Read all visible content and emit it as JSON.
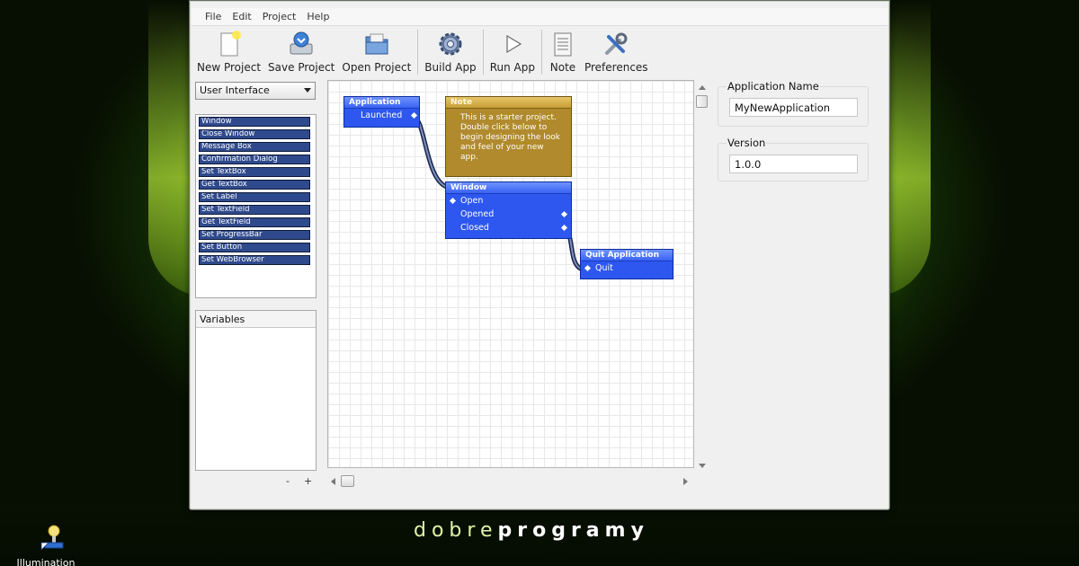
{
  "menu": [
    "File",
    "Edit",
    "Project",
    "Help"
  ],
  "toolbar": {
    "new_project": "New Project",
    "save_project": "Save Project",
    "open_project": "Open Project",
    "build_app": "Build App",
    "run_app": "Run App",
    "note": "Note",
    "preferences": "Preferences"
  },
  "palette": {
    "category": "User Interface",
    "items": [
      "Window",
      "Close Window",
      "Message Box",
      "Confirmation Dialog",
      "Set TextBox",
      "Get TextBox",
      "Set Label",
      "Set TextField",
      "Get TextField",
      "Set ProgressBar",
      "Set Button",
      "Set WebBrowser"
    ]
  },
  "variables": {
    "title": "Variables",
    "remove": "-",
    "add": "+"
  },
  "canvas": {
    "application": {
      "title": "Application",
      "ports": [
        "Launched"
      ]
    },
    "note": {
      "title": "Note",
      "text": "This is a starter project.  Double click below to begin designing the look and feel of your new app."
    },
    "window_block": {
      "title": "Window",
      "ports": [
        "Open",
        "Opened",
        "Closed"
      ]
    },
    "quit_block": {
      "title": "Quit Application",
      "ports": [
        "Quit"
      ]
    }
  },
  "properties": {
    "app_name_label": "Application Name",
    "app_name_value": "MyNewApplication",
    "version_label": "Version",
    "version_value": "1.0.0"
  },
  "desktop": {
    "icon_label": "Illumination"
  },
  "watermark": {
    "light": "dobre",
    "bold": "programy"
  }
}
